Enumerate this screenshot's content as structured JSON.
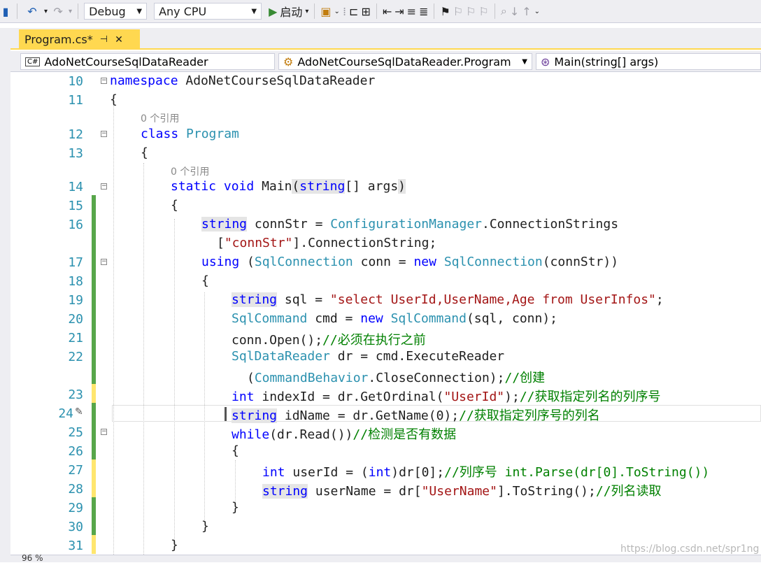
{
  "toolbar": {
    "configuration": "Debug",
    "platform": "Any CPU",
    "start_label": "启动"
  },
  "tab": {
    "title": "Program.cs*",
    "pin": "⊣",
    "close": "✕"
  },
  "nav": {
    "project": "AdoNetCourseSqlDataReader",
    "class": "AdoNetCourseSqlDataReader.Program",
    "member": "Main(string[] args)"
  },
  "code": {
    "references_0": "0 个引用",
    "references_1": "0 个引用",
    "lines": [
      {
        "n": "10",
        "text": "namespace AdoNetCourseSqlDataReader"
      },
      {
        "n": "11",
        "text": "{"
      },
      {
        "n": "12",
        "text": "class Program"
      },
      {
        "n": "13",
        "text": "{"
      },
      {
        "n": "14",
        "text": "static void Main(string[] args)"
      },
      {
        "n": "15",
        "text": "{"
      },
      {
        "n": "16",
        "text": "string connStr = ConfigurationManager.ConnectionStrings"
      },
      {
        "n": "",
        "text": "[\"connStr\"].ConnectionString;"
      },
      {
        "n": "17",
        "text": "using (SqlConnection conn = new SqlConnection(connStr))"
      },
      {
        "n": "18",
        "text": "{"
      },
      {
        "n": "19",
        "text": "string sql = \"select UserId,UserName,Age from UserInfos\";"
      },
      {
        "n": "20",
        "text": "SqlCommand cmd = new SqlCommand(sql, conn);"
      },
      {
        "n": "21",
        "text": "conn.Open();//必须在执行之前"
      },
      {
        "n": "22",
        "text": "SqlDataReader dr = cmd.ExecuteReader"
      },
      {
        "n": "",
        "text": "(CommandBehavior.CloseConnection);//创建"
      },
      {
        "n": "23",
        "text": "int indexId = dr.GetOrdinal(\"UserId\");//获取指定列名的列序号"
      },
      {
        "n": "24",
        "text": "string idName = dr.GetName(0);//获取指定列序号的列名"
      },
      {
        "n": "25",
        "text": "while(dr.Read())//检测是否有数据"
      },
      {
        "n": "26",
        "text": "{"
      },
      {
        "n": "27",
        "text": "int userId = (int)dr[0];//列序号 int.Parse(dr[0].ToString())"
      },
      {
        "n": "28",
        "text": "string userName = dr[\"UserName\"].ToString();//列名读取"
      },
      {
        "n": "29",
        "text": "}"
      },
      {
        "n": "30",
        "text": "}"
      },
      {
        "n": "31",
        "text": "}"
      }
    ]
  },
  "status": {
    "zoom": "96 %"
  },
  "watermark": "https://blog.csdn.net/spr1ng"
}
